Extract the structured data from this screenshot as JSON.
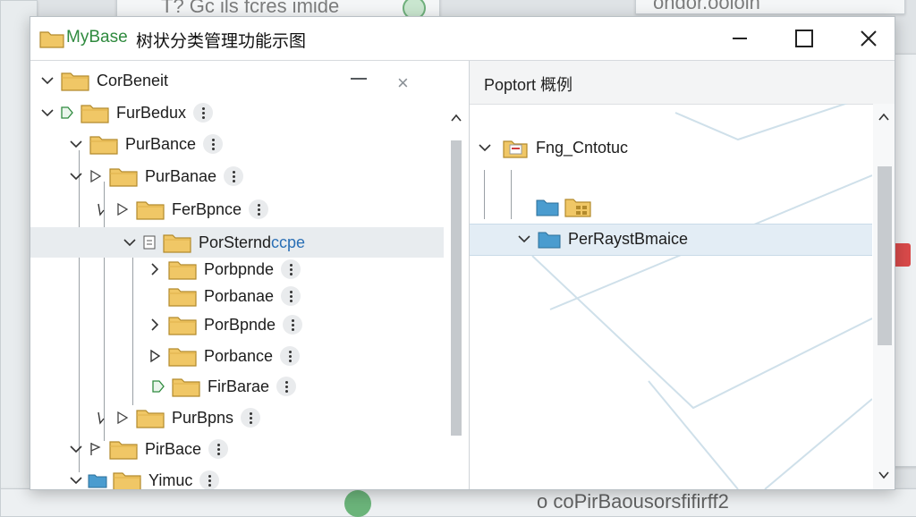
{
  "background": {
    "top_text": "T? Gc ils fcres imide",
    "top_right_text": "ondor.ooioin",
    "bottom_text": "o coPirBaousorsfifirff2"
  },
  "titlebar": {
    "app_name": "MyBase",
    "app_description": "树状分类管理功能示图",
    "minimize_label": "minimize",
    "maximize_label": "maximize",
    "close_label": "close"
  },
  "tree": {
    "items": [
      {
        "label": "CorBeneit"
      },
      {
        "label": "FurBedux"
      },
      {
        "label": "PurBance"
      },
      {
        "label": "PurBanae"
      },
      {
        "label": "FerBpnce"
      },
      {
        "label": "PorSterndccpe",
        "highlight": "ccpe"
      },
      {
        "label": "Porbpnde"
      },
      {
        "label": "Porbanae"
      },
      {
        "label": "PorBpnde"
      },
      {
        "label": "Porbance"
      },
      {
        "label": "FirBarae"
      },
      {
        "label": "PurBpns"
      },
      {
        "label": "PirBace"
      },
      {
        "label": "Yimuc"
      }
    ]
  },
  "preview": {
    "title": "Poptort 概例",
    "items": [
      {
        "label": "Fng_Cntotuc"
      },
      {
        "label": ""
      },
      {
        "label": "PerRaystBmaice"
      }
    ]
  },
  "colors": {
    "accent_green": "#2f8a3e",
    "folder_yellow": "#f0c766",
    "folder_blue": "#4a9ccf",
    "selection": "#e3edf5"
  }
}
